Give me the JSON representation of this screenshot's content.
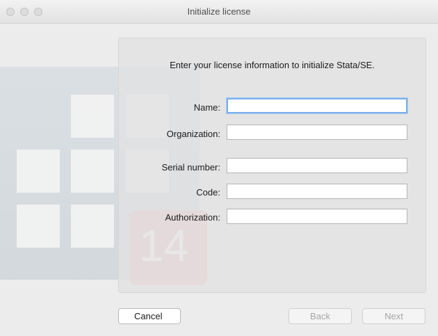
{
  "window": {
    "title": "Initialize license"
  },
  "art": {
    "badge_number": "14",
    "badge_color": "#f2b8b8"
  },
  "form": {
    "prompt": "Enter your license information to initialize Stata/SE.",
    "fields": [
      {
        "label": "Name:",
        "value": "",
        "focused": true
      },
      {
        "label": "Organization:",
        "value": ""
      },
      {
        "label": "Serial number:",
        "value": ""
      },
      {
        "label": "Code:",
        "value": ""
      },
      {
        "label": "Authorization:",
        "value": ""
      }
    ]
  },
  "buttons": {
    "cancel": "Cancel",
    "back": "Back",
    "next": "Next"
  },
  "colors": {
    "focus_ring": "#7aaeea",
    "window_bg": "#ececec"
  }
}
